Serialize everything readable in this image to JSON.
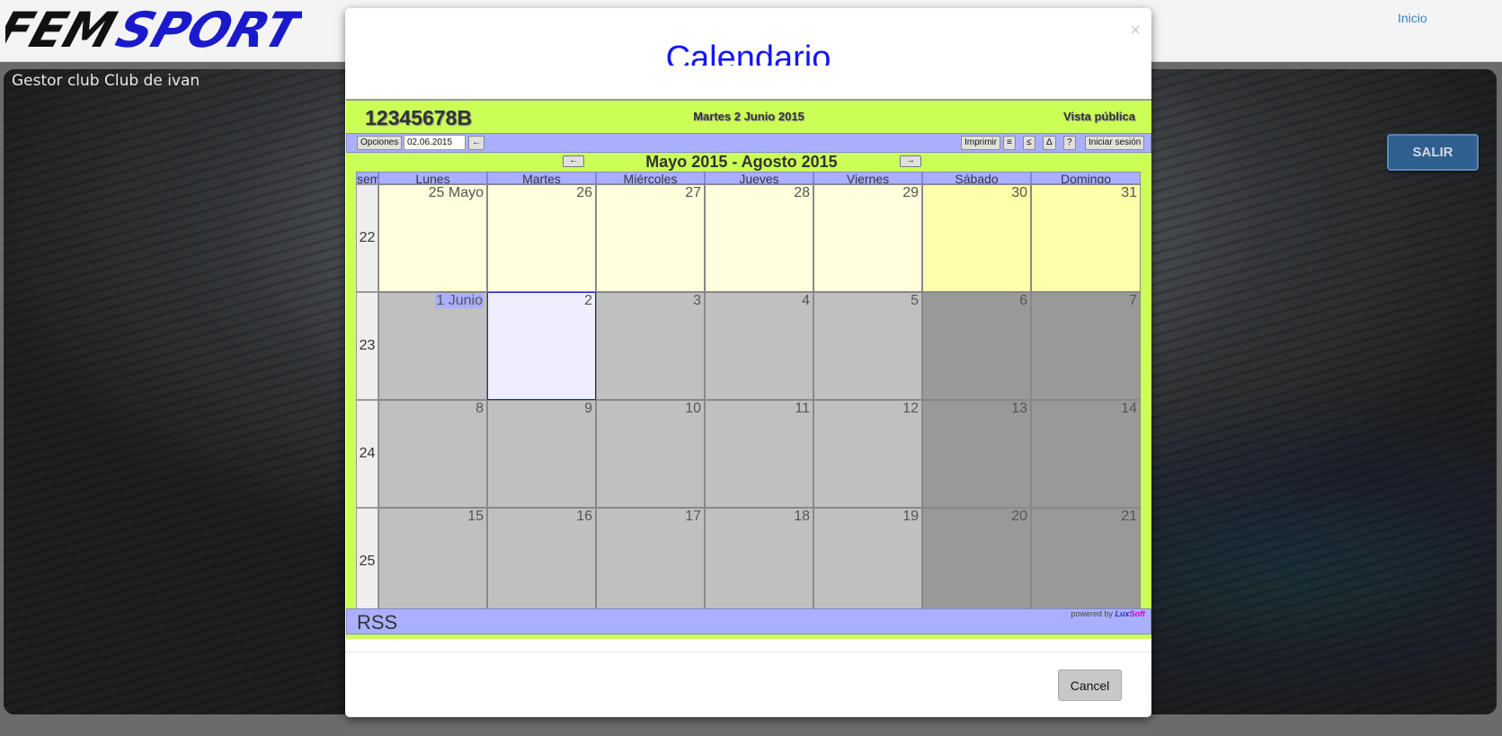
{
  "topbar": {
    "logo_text": "FEMSPORT",
    "nav_inicio": "Inicio"
  },
  "club": {
    "title": "Gestor club Club de ivan",
    "salir_label": "SALIR"
  },
  "modal": {
    "title": "Calendario",
    "cancel_label": "Cancel"
  },
  "calendar": {
    "id": "12345678B",
    "current_date": "Martes 2 Junio 2015",
    "view_label": "Vista pública",
    "toolbar": {
      "opciones": "Opciones",
      "date_value": "02.06.2015",
      "back_btn": "←",
      "imprimir": "Imprimir",
      "list_btn": "≡",
      "le_btn": "≤",
      "delta_btn": "Δ",
      "help_btn": "?",
      "login_btn": "Iniciar sesión"
    },
    "range_title": "Mayo 2015 - Agosto 2015",
    "prev_arrow": "←",
    "next_arrow": "→",
    "week_header": "sem",
    "day_headers": [
      "Lunes",
      "Martes",
      "Miércoles",
      "Jueves",
      "Viernes",
      "Sábado",
      "Domingo"
    ],
    "weeks": [
      {
        "num": "22",
        "days": [
          "25 Mayo",
          "26",
          "27",
          "28",
          "29",
          "30",
          "31"
        ]
      },
      {
        "num": "23",
        "days": [
          "1 Junio",
          "2",
          "3",
          "4",
          "5",
          "6",
          "7"
        ]
      },
      {
        "num": "24",
        "days": [
          "8",
          "9",
          "10",
          "11",
          "12",
          "13",
          "14"
        ]
      },
      {
        "num": "25",
        "days": [
          "15",
          "16",
          "17",
          "18",
          "19",
          "20",
          "21"
        ]
      }
    ],
    "footer": {
      "rss": "RSS",
      "powered_by": "powered by",
      "brand_lux": "Lux",
      "brand_soft": "Soft"
    }
  },
  "colors": {
    "calendar_bg": "#ccff55",
    "header_band": "#aab0ff",
    "may_weekday": "#ffffdd",
    "may_weekend": "#ffffaa",
    "june_weekday": "#c0c0c0",
    "june_weekend": "#999999",
    "today": "#eeeeff",
    "modal_title": "#1515ff",
    "salir_button": "#2f5f8f"
  }
}
